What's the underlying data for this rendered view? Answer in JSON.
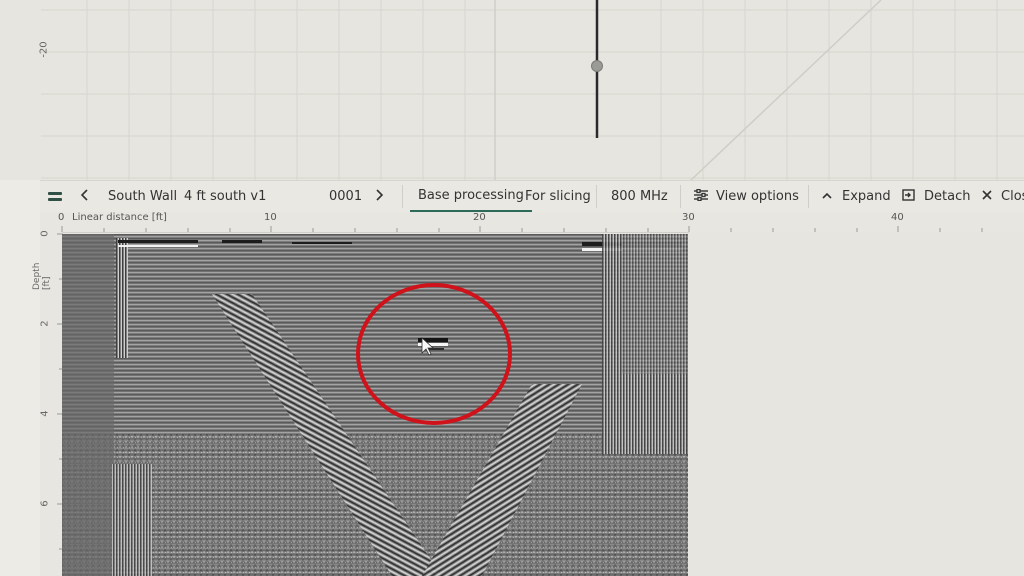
{
  "top_plot": {
    "y_tick": "-20"
  },
  "toolbar": {
    "menu_icon": "hamburger-icon",
    "prev_icon": "chevron-left-icon",
    "site_name": "South Wall",
    "scan_name": "4 ft south v1",
    "scan_number": "0001",
    "next_icon": "chevron-right-icon",
    "tabs": [
      {
        "label": "Base processing",
        "active": true
      },
      {
        "label": "For slicing",
        "active": false
      }
    ],
    "frequency": "800 MHz",
    "view_options_label": "View options",
    "expand_label": "Expand",
    "detach_label": "Detach",
    "close_label": "Clos"
  },
  "ruler": {
    "axis_title": "Linear distance [ft]",
    "ticks": [
      "0",
      "10",
      "20",
      "30",
      "40"
    ]
  },
  "depth_axis": {
    "axis_title": "Depth [ft]",
    "ticks": [
      "0",
      "2",
      "4",
      "6"
    ]
  },
  "colors": {
    "accent": "#2e6a5a",
    "highlight_circle": "#d0121b",
    "background": "#e7e6e1"
  }
}
